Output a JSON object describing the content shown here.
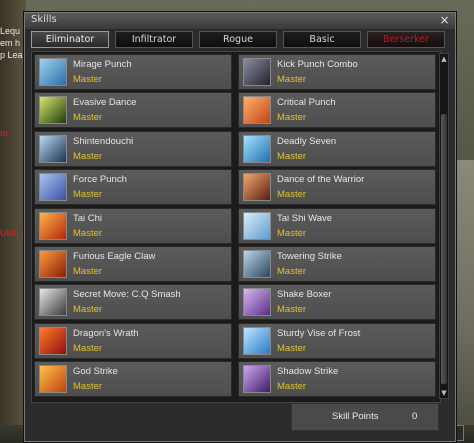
{
  "window": {
    "title": "Skills",
    "close_glyph": "×"
  },
  "background_text": [
    "Lequ",
    "em h",
    "p Lea",
    "in",
    "UkIe"
  ],
  "tabs": [
    {
      "label": "Eliminator",
      "state": "active"
    },
    {
      "label": "Infiltrator",
      "state": "normal"
    },
    {
      "label": "Rogue",
      "state": "normal"
    },
    {
      "label": "Basic",
      "state": "normal"
    },
    {
      "label": "Berserker",
      "state": "disabled"
    }
  ],
  "skills_left": [
    {
      "name": "Mirage Punch",
      "rank": "Master",
      "icon": "mirage-punch-icon"
    },
    {
      "name": "Evasive Dance",
      "rank": "Master",
      "icon": "evasive-dance-icon"
    },
    {
      "name": "Shintendouchi",
      "rank": "Master",
      "icon": "shintendouchi-icon"
    },
    {
      "name": "Force Punch",
      "rank": "Master",
      "icon": "force-punch-icon"
    },
    {
      "name": "Tai Chi",
      "rank": "Master",
      "icon": "tai-chi-icon"
    },
    {
      "name": "Furious Eagle Claw",
      "rank": "Master",
      "icon": "furious-eagle-claw-icon"
    },
    {
      "name": "Secret Move: C.Q Smash",
      "rank": "Master",
      "icon": "secret-move-icon"
    },
    {
      "name": "Dragon's Wrath",
      "rank": "Master",
      "icon": "dragons-wrath-icon"
    },
    {
      "name": "God Strike",
      "rank": "Master",
      "icon": "god-strike-icon"
    }
  ],
  "skills_right": [
    {
      "name": "Kick Punch Combo",
      "rank": "Master",
      "icon": "kick-punch-combo-icon"
    },
    {
      "name": "Critical Punch",
      "rank": "Master",
      "icon": "critical-punch-icon"
    },
    {
      "name": "Deadly Seven",
      "rank": "Master",
      "icon": "deadly-seven-icon"
    },
    {
      "name": "Dance of the Warrior",
      "rank": "Master",
      "icon": "dance-of-the-warrior-icon"
    },
    {
      "name": "Tai Shi Wave",
      "rank": "Master",
      "icon": "tai-shi-wave-icon"
    },
    {
      "name": "Towering Strike",
      "rank": "Master",
      "icon": "towering-strike-icon"
    },
    {
      "name": "Shake Boxer",
      "rank": "Master",
      "icon": "shake-boxer-icon"
    },
    {
      "name": "Sturdy Vise of Frost",
      "rank": "Master",
      "icon": "sturdy-vise-of-frost-icon"
    },
    {
      "name": "Shadow Strike",
      "rank": "Master",
      "icon": "shadow-strike-icon"
    }
  ],
  "footer": {
    "skill_points_label": "Skill Points",
    "skill_points_value": "0"
  },
  "colors": {
    "rank_text": "#e2c12e",
    "disabled_tab": "#b21e1e"
  }
}
